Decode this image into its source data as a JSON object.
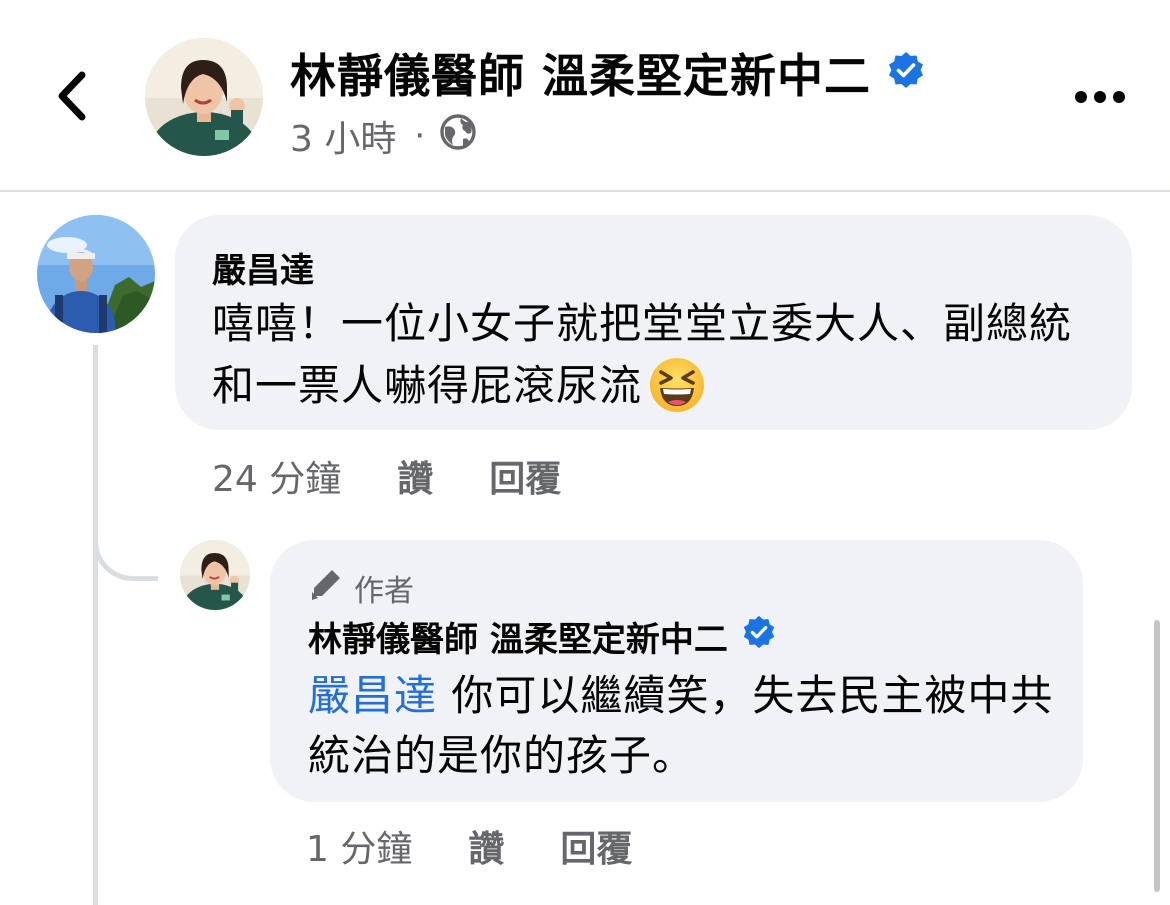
{
  "header": {
    "page_name": "林靜儀醫師 溫柔堅定新中二",
    "post_time": "3 小時",
    "separator": "·",
    "audience_icon": "globe-icon",
    "back_icon": "chevron-left-icon",
    "more_icon": "more-horizontal-icon",
    "verified_icon": "verified-badge-icon"
  },
  "comments": [
    {
      "author": "嚴昌達",
      "text": "嘻嘻！一位小女子就把堂堂立委大人、副總統和一票人嚇得屁滾尿流",
      "emoji": "grinning-squinting-face-icon",
      "time": "24 分鐘",
      "like_label": "讚",
      "reply_label": "回覆"
    }
  ],
  "reply": {
    "badge_icon": "pen-icon",
    "badge_label": "作者",
    "author": "林靜儀醫師 溫柔堅定新中二",
    "mention": "嚴昌達",
    "text": " 你可以繼續笑，失去民主被中共統治的是你的孩子。",
    "time": "1 分鐘",
    "like_label": "讚",
    "reply_label": "回覆"
  },
  "colors": {
    "verified": "#1b74e4",
    "mention": "#216fdb",
    "bubble": "#f0f2f5",
    "secondary_text": "#65676b"
  }
}
